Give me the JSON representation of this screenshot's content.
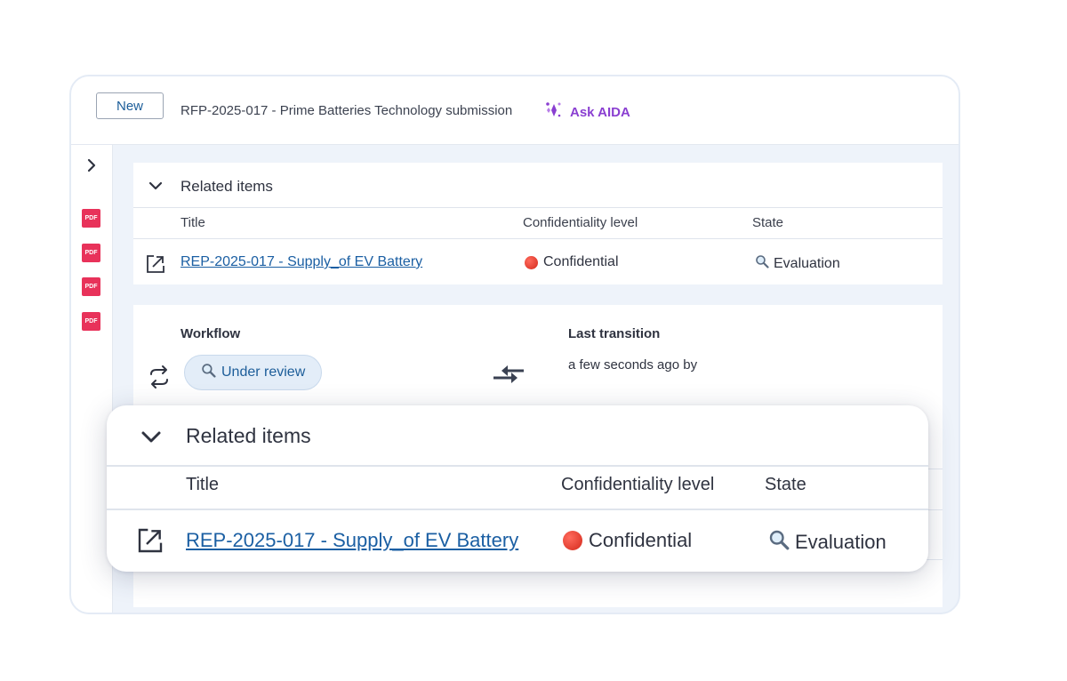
{
  "header": {
    "new_label": "New",
    "document_title": "RFP-2025-017 - Prime Batteries Technology submission",
    "ask_aida_label": "Ask AIDA"
  },
  "sidebar": {
    "attachments": [
      {
        "label": "PDF"
      },
      {
        "label": "PDF"
      },
      {
        "label": "PDF"
      },
      {
        "label": "PDF"
      }
    ]
  },
  "related_items": {
    "section_title": "Related items",
    "columns": [
      "Title",
      "Confidentiality level",
      "State"
    ],
    "rows": [
      {
        "title": "REP-2025-017 - Supply_of EV Battery",
        "confidentiality": "Confidential",
        "state": "Evaluation"
      }
    ]
  },
  "workflow": {
    "label": "Workflow",
    "status": "Under review",
    "last_transition_label": "Last transition",
    "last_transition_value": "a few seconds ago by"
  },
  "colors": {
    "link": "#1b5fa3",
    "aida_purple": "#8a3fd1",
    "pdf_red": "#e8325a",
    "confidential_red": "#d42a1c"
  }
}
